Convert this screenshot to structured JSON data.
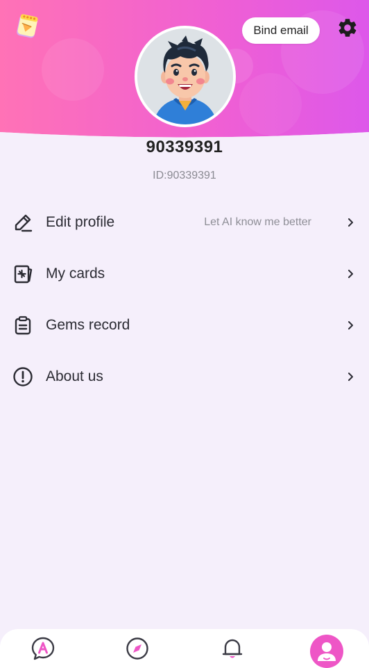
{
  "colors": {
    "header_gradient_start": "#ff6fb7",
    "header_gradient_end": "#e057e8",
    "accent": "#ee56c6",
    "background": "#f5effb"
  },
  "header": {
    "logo_icon": "notepad-logo-icon",
    "bind_email_label": "Bind email",
    "settings_icon": "gear-icon"
  },
  "profile": {
    "username": "90339391",
    "id_text": "ID:90339391",
    "avatar": "cartoon-boy-avatar"
  },
  "menu": [
    {
      "icon": "pencil-icon",
      "label": "Edit profile",
      "hint": "Let AI know me better"
    },
    {
      "icon": "card-star-icon",
      "label": "My cards",
      "hint": ""
    },
    {
      "icon": "clipboard-icon",
      "label": "Gems record",
      "hint": ""
    },
    {
      "icon": "exclamation-circle-icon",
      "label": "About us",
      "hint": ""
    }
  ],
  "tabbar": {
    "tabs": [
      {
        "icon": "ai-chat-icon",
        "active": false
      },
      {
        "icon": "compass-icon",
        "active": false
      },
      {
        "icon": "bell-icon",
        "active": false
      },
      {
        "icon": "user-icon",
        "active": true
      }
    ]
  }
}
